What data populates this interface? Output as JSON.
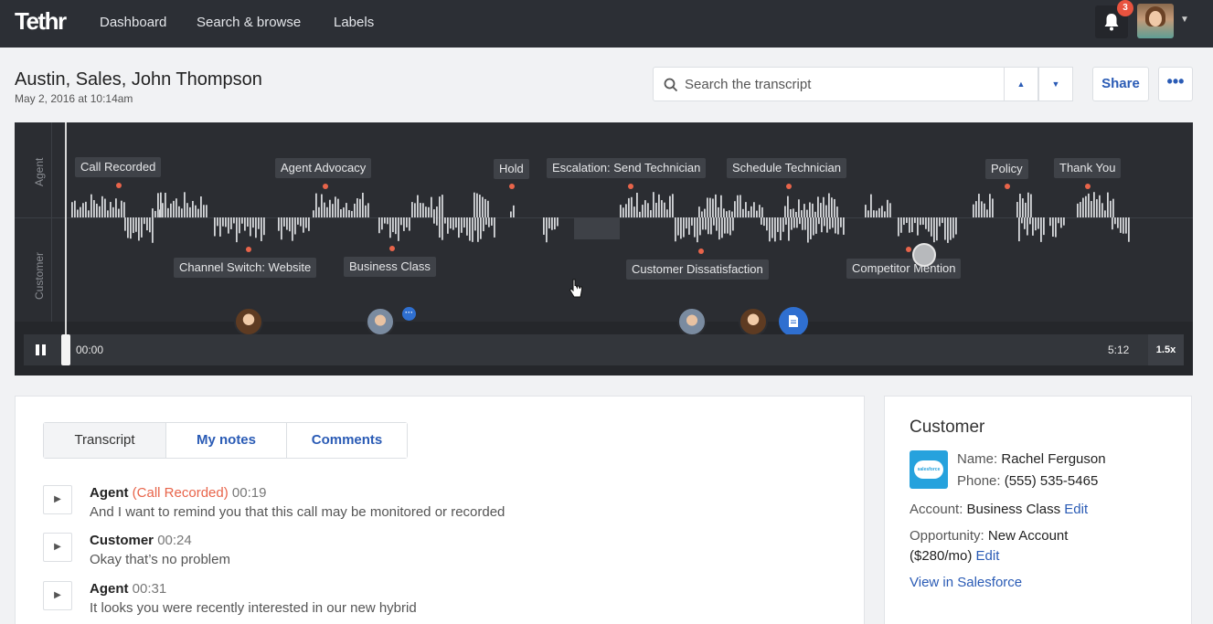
{
  "app": {
    "logo": "Tethr",
    "nav": [
      "Dashboard",
      "Search & browse",
      "Labels"
    ],
    "notification_count": "3"
  },
  "call": {
    "title": "Austin, Sales, John Thompson",
    "date": "May 2, 2016 at 10:14am"
  },
  "search": {
    "placeholder": "Search the transcript",
    "value": ""
  },
  "actions": {
    "share": "Share",
    "more": "•••"
  },
  "player": {
    "agent_label": "Agent",
    "customer_label": "Customer",
    "agent_events": [
      "Call Recorded",
      "Agent Advocacy",
      "Hold",
      "Escalation: Send Technician",
      "Schedule Technician",
      "Policy",
      "Thank You"
    ],
    "customer_events": [
      "Channel Switch: Website",
      "Business Class",
      "Customer Dissatisfaction",
      "Competitor Mention"
    ],
    "current_time": "00:00",
    "duration": "5:12",
    "speed": "1.5x",
    "progress": 0
  },
  "tabs": [
    "Transcript",
    "My notes",
    "Comments"
  ],
  "transcript": [
    {
      "speaker": "Agent",
      "tag": "Call Recorded",
      "time": "00:19",
      "text": "And I want to remind you that this call may be monitored or recorded"
    },
    {
      "speaker": "Customer",
      "tag": "",
      "time": "00:24",
      "text": "Okay that’s no problem"
    },
    {
      "speaker": "Agent",
      "tag": "",
      "time": "00:31",
      "text": "It looks you were recently interested in our new hybrid"
    }
  ],
  "customer": {
    "heading": "Customer",
    "name_label": "Name:",
    "name": "Rachel Ferguson",
    "phone_label": "Phone:",
    "phone": "(555) 535-5465",
    "account_label": "Account:",
    "account": "Business Class",
    "opportunity_label": "Opportunity:",
    "opportunity": "New Account",
    "opportunity_amount": "($280/mo)",
    "edit": "Edit",
    "view_link": "View in Salesforce",
    "logo_text": "salesforce"
  },
  "colors": {
    "accent": "#2a5bb5",
    "event_dot": "#e8644a",
    "player_bg": "#2b2d32"
  }
}
